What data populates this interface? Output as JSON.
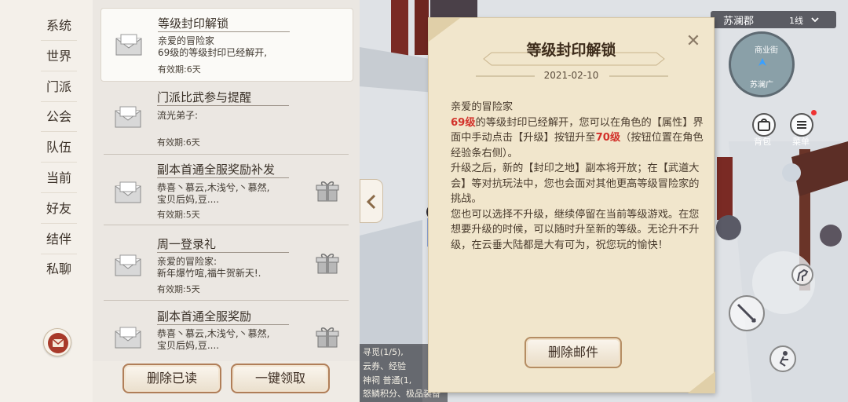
{
  "channels": [
    "系统",
    "世界",
    "门派",
    "公会",
    "队伍",
    "当前",
    "好友",
    "结伴",
    "私聊"
  ],
  "mails": [
    {
      "title": "等级封印解锁",
      "body": [
        "亲爱的冒险家",
        "69级的等级封印已经解开,"
      ],
      "expiry": "有效期:6天",
      "has_gift": false,
      "selected": true
    },
    {
      "title": "门派比武参与提醒",
      "body": [
        "流光弟子:"
      ],
      "expiry": "有效期:6天",
      "has_gift": false,
      "selected": false
    },
    {
      "title": "副本首通全服奖励补发",
      "body": [
        "恭喜丶慕云,木浅兮,丶慕然,",
        "宝贝后妈,豆...."
      ],
      "expiry": "有效期:5天",
      "has_gift": true,
      "selected": false
    },
    {
      "title": "周一登录礼",
      "body": [
        "亲爱的冒险家:",
        "新年爆竹喧,福牛贺新天!."
      ],
      "expiry": "有效期:5天",
      "has_gift": true,
      "selected": false
    },
    {
      "title": "副本首通全服奖励",
      "body": [
        "恭喜丶慕云,木浅兮,丶慕然,",
        "宝贝后妈,豆...."
      ],
      "expiry": "有效期:5天",
      "has_gift": true,
      "selected": false
    }
  ],
  "buttons": {
    "delete_read": "删除已读",
    "claim_all": "一键领取",
    "delete_mail": "删除邮件"
  },
  "letter": {
    "title": "等级封印解锁",
    "date": "2021-02-10",
    "greeting": "亲爱的冒险家",
    "level_from": "69级",
    "level_to": "70级",
    "text1": "的等级封印已经解开，您可以在角色的【属性】界面中手动点击【升级】按钮升至",
    "text2": "（按钮位置在角色经验条右侧）。",
    "para2": "升级之后，新的【封印之地】副本将开放；在【武道大会】等对抗玩法中，您也会面对其他更高等级冒险家的挑战。",
    "para3": "您也可以选择不升级，继续停留在当前等级游戏。在您想要升级的时候，可以随时升至新的等级。无论升不升级，在云垂大陆都是大有可为，祝您玩的愉快！",
    "close_glyph": "✕"
  },
  "hud": {
    "location": "苏澜郡",
    "server": "1线",
    "map_label_1": "商业街",
    "map_label_2": "苏澜广",
    "bag_label": "背包",
    "menu_label": "菜单"
  },
  "chat": [
    "寻觅(1/5),",
    "云券、经验",
    "神祠 普通(1,",
    "怒鳞积分、极品装备"
  ],
  "colors": {
    "accent_red": "#d2312a",
    "button_border": "#b07e58",
    "panel_bg": "#ebe7e2"
  }
}
